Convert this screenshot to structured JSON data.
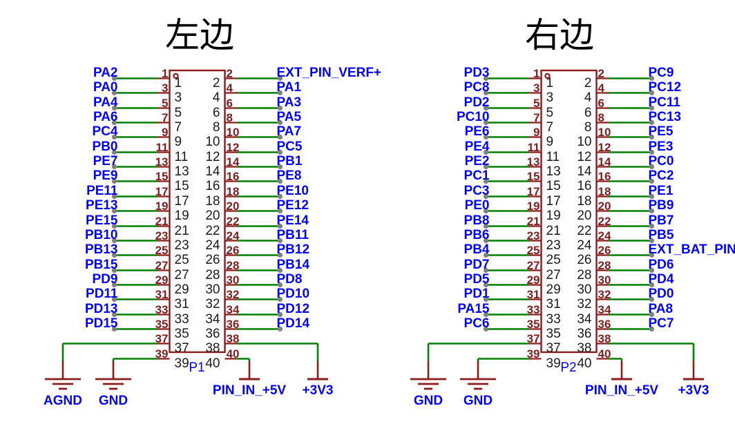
{
  "sheet": {
    "background": "#ffffff",
    "wire_color": "#007f00",
    "pin_color": "#8b1a1a",
    "body_color": "#8b1a1a",
    "label_color": "#0000ff",
    "title_color": "#000000",
    "node_color": "#808080"
  },
  "titles": {
    "left": "左边",
    "right": "右边"
  },
  "left_connector": {
    "refdes": "P1",
    "marker": "pin1-dot",
    "odd_rows": [
      {
        "pin": "1",
        "num_inner": "1",
        "net": "PA2"
      },
      {
        "pin": "3",
        "num_inner": "3",
        "net": "PA0"
      },
      {
        "pin": "5",
        "num_inner": "5",
        "net": "PA4"
      },
      {
        "pin": "7",
        "num_inner": "7",
        "net": "PA6"
      },
      {
        "pin": "9",
        "num_inner": "9",
        "net": "PC4"
      },
      {
        "pin": "11",
        "num_inner": "11",
        "net": "PB0"
      },
      {
        "pin": "13",
        "num_inner": "13",
        "net": "PE7"
      },
      {
        "pin": "15",
        "num_inner": "15",
        "net": "PE9"
      },
      {
        "pin": "17",
        "num_inner": "17",
        "net": "PE11"
      },
      {
        "pin": "19",
        "num_inner": "19",
        "net": "PE13"
      },
      {
        "pin": "21",
        "num_inner": "21",
        "net": "PE15"
      },
      {
        "pin": "23",
        "num_inner": "23",
        "net": "PB10"
      },
      {
        "pin": "25",
        "num_inner": "25",
        "net": "PB13"
      },
      {
        "pin": "27",
        "num_inner": "27",
        "net": "PB15"
      },
      {
        "pin": "29",
        "num_inner": "29",
        "net": "PD9"
      },
      {
        "pin": "31",
        "num_inner": "31",
        "net": "PD11"
      },
      {
        "pin": "33",
        "num_inner": "33",
        "net": "PD13"
      },
      {
        "pin": "35",
        "num_inner": "35",
        "net": "PD15"
      },
      {
        "pin": "37",
        "num_inner": "37",
        "net": ""
      },
      {
        "pin": "39",
        "num_inner": "39",
        "net": ""
      }
    ],
    "even_rows": [
      {
        "pin": "2",
        "num_inner": "2",
        "net": "EXT_PIN_VERF+"
      },
      {
        "pin": "4",
        "num_inner": "4",
        "net": "PA1"
      },
      {
        "pin": "6",
        "num_inner": "6",
        "net": "PA3"
      },
      {
        "pin": "8",
        "num_inner": "8",
        "net": "PA5"
      },
      {
        "pin": "10",
        "num_inner": "10",
        "net": "PA7"
      },
      {
        "pin": "12",
        "num_inner": "12",
        "net": "PC5"
      },
      {
        "pin": "14",
        "num_inner": "14",
        "net": "PB1"
      },
      {
        "pin": "16",
        "num_inner": "16",
        "net": "PE8"
      },
      {
        "pin": "18",
        "num_inner": "18",
        "net": "PE10"
      },
      {
        "pin": "20",
        "num_inner": "20",
        "net": "PE12"
      },
      {
        "pin": "22",
        "num_inner": "22",
        "net": "PE14"
      },
      {
        "pin": "24",
        "num_inner": "24",
        "net": "PB11"
      },
      {
        "pin": "26",
        "num_inner": "26",
        "net": "PB12"
      },
      {
        "pin": "28",
        "num_inner": "28",
        "net": "PB14"
      },
      {
        "pin": "30",
        "num_inner": "30",
        "net": "PD8"
      },
      {
        "pin": "32",
        "num_inner": "32",
        "net": "PD10"
      },
      {
        "pin": "34",
        "num_inner": "34",
        "net": "PD12"
      },
      {
        "pin": "36",
        "num_inner": "36",
        "net": "PD14"
      },
      {
        "pin": "38",
        "num_inner": "38",
        "net": ""
      },
      {
        "pin": "40",
        "num_inner": "40",
        "net": ""
      }
    ],
    "power_symbols": [
      {
        "type": "ground",
        "label": "AGND",
        "from_pin": "37"
      },
      {
        "type": "ground",
        "label": "GND",
        "from_pin": "39"
      },
      {
        "type": "power",
        "label": "PIN_IN_+5V",
        "from_pin": "40"
      },
      {
        "type": "power",
        "label": "+3V3",
        "from_pin": "38"
      }
    ]
  },
  "right_connector": {
    "refdes": "P2",
    "marker": "pin1-dot",
    "odd_rows": [
      {
        "pin": "1",
        "num_inner": "1",
        "net": "PD3"
      },
      {
        "pin": "3",
        "num_inner": "3",
        "net": "PC8"
      },
      {
        "pin": "5",
        "num_inner": "5",
        "net": "PD2"
      },
      {
        "pin": "7",
        "num_inner": "7",
        "net": "PC10"
      },
      {
        "pin": "9",
        "num_inner": "9",
        "net": "PE6"
      },
      {
        "pin": "11",
        "num_inner": "11",
        "net": "PE4"
      },
      {
        "pin": "13",
        "num_inner": "13",
        "net": "PE2"
      },
      {
        "pin": "15",
        "num_inner": "15",
        "net": "PC1"
      },
      {
        "pin": "17",
        "num_inner": "17",
        "net": "PC3"
      },
      {
        "pin": "19",
        "num_inner": "19",
        "net": "PE0"
      },
      {
        "pin": "21",
        "num_inner": "21",
        "net": "PB8"
      },
      {
        "pin": "23",
        "num_inner": "23",
        "net": "PB6"
      },
      {
        "pin": "25",
        "num_inner": "25",
        "net": "PB4"
      },
      {
        "pin": "27",
        "num_inner": "27",
        "net": "PD7"
      },
      {
        "pin": "29",
        "num_inner": "29",
        "net": "PD5"
      },
      {
        "pin": "31",
        "num_inner": "31",
        "net": "PD1"
      },
      {
        "pin": "33",
        "num_inner": "33",
        "net": "PA15"
      },
      {
        "pin": "35",
        "num_inner": "35",
        "net": "PC6"
      },
      {
        "pin": "37",
        "num_inner": "37",
        "net": ""
      },
      {
        "pin": "39",
        "num_inner": "39",
        "net": ""
      }
    ],
    "even_rows": [
      {
        "pin": "2",
        "num_inner": "2",
        "net": "PC9"
      },
      {
        "pin": "4",
        "num_inner": "4",
        "net": "PC12"
      },
      {
        "pin": "6",
        "num_inner": "6",
        "net": "PC11"
      },
      {
        "pin": "8",
        "num_inner": "8",
        "net": "PC13"
      },
      {
        "pin": "10",
        "num_inner": "10",
        "net": "PE5"
      },
      {
        "pin": "12",
        "num_inner": "12",
        "net": "PE3"
      },
      {
        "pin": "14",
        "num_inner": "14",
        "net": "PC0"
      },
      {
        "pin": "16",
        "num_inner": "16",
        "net": "PC2"
      },
      {
        "pin": "18",
        "num_inner": "18",
        "net": "PE1"
      },
      {
        "pin": "20",
        "num_inner": "20",
        "net": "PB9"
      },
      {
        "pin": "22",
        "num_inner": "22",
        "net": "PB7"
      },
      {
        "pin": "24",
        "num_inner": "24",
        "net": "PB5"
      },
      {
        "pin": "26",
        "num_inner": "26",
        "net": "EXT_BAT_PIN+"
      },
      {
        "pin": "28",
        "num_inner": "28",
        "net": "PD6"
      },
      {
        "pin": "30",
        "num_inner": "30",
        "net": "PD4"
      },
      {
        "pin": "32",
        "num_inner": "32",
        "net": "PD0"
      },
      {
        "pin": "34",
        "num_inner": "34",
        "net": "PA8"
      },
      {
        "pin": "36",
        "num_inner": "36",
        "net": "PC7"
      },
      {
        "pin": "38",
        "num_inner": "38",
        "net": ""
      },
      {
        "pin": "40",
        "num_inner": "40",
        "net": ""
      }
    ],
    "power_symbols": [
      {
        "type": "ground",
        "label": "GND",
        "from_pin": "37"
      },
      {
        "type": "ground",
        "label": "GND",
        "from_pin": "39"
      },
      {
        "type": "power",
        "label": "PIN_IN_+5V",
        "from_pin": "40"
      },
      {
        "type": "power",
        "label": "+3V3",
        "from_pin": "38"
      }
    ]
  }
}
